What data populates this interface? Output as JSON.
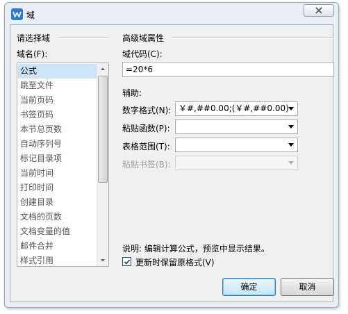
{
  "window": {
    "title": "域",
    "app_icon": "wps-writer-icon"
  },
  "left_panel": {
    "group_title": "请选择域",
    "list_label": "域名(F):",
    "items": [
      {
        "label": "公式",
        "selected": true
      },
      {
        "label": "跳至文件",
        "selected": false
      },
      {
        "label": "当前页码",
        "selected": false
      },
      {
        "label": "书签页码",
        "selected": false
      },
      {
        "label": "本节总页数",
        "selected": false
      },
      {
        "label": "自动序列号",
        "selected": false
      },
      {
        "label": "标记目录项",
        "selected": false
      },
      {
        "label": "当前时间",
        "selected": false
      },
      {
        "label": "打印时间",
        "selected": false
      },
      {
        "label": "创建目录",
        "selected": false
      },
      {
        "label": "文档的页数",
        "selected": false
      },
      {
        "label": "文档变量的值",
        "selected": false
      },
      {
        "label": "邮件合并",
        "selected": false
      },
      {
        "label": "样式引用",
        "selected": false
      }
    ]
  },
  "right_panel": {
    "group_title": "高级域属性",
    "code_label": "域代码(C):",
    "code_value": "=20*6",
    "aux_label": "辅助:",
    "number_format_label": "数字格式(N):",
    "number_format_value": "￥#,##0.00;(￥#,##0.00)",
    "paste_function_label": "粘贴函数(P):",
    "paste_function_value": "",
    "table_range_label": "表格范围(T):",
    "table_range_value": "",
    "paste_bookmark_label": "粘贴书签(B):",
    "paste_bookmark_value": "",
    "description": "说明: 编辑计算公式，预览中显示结果。",
    "preserve_format_label": "更新时保留原格式(V)",
    "preserve_format_checked": true
  },
  "buttons": {
    "ok": "确定",
    "cancel": "取消"
  },
  "colors": {
    "selection": "#cbe4f7",
    "default_button_border": "#3c7fb1",
    "window_frame": "#e9eef5"
  }
}
